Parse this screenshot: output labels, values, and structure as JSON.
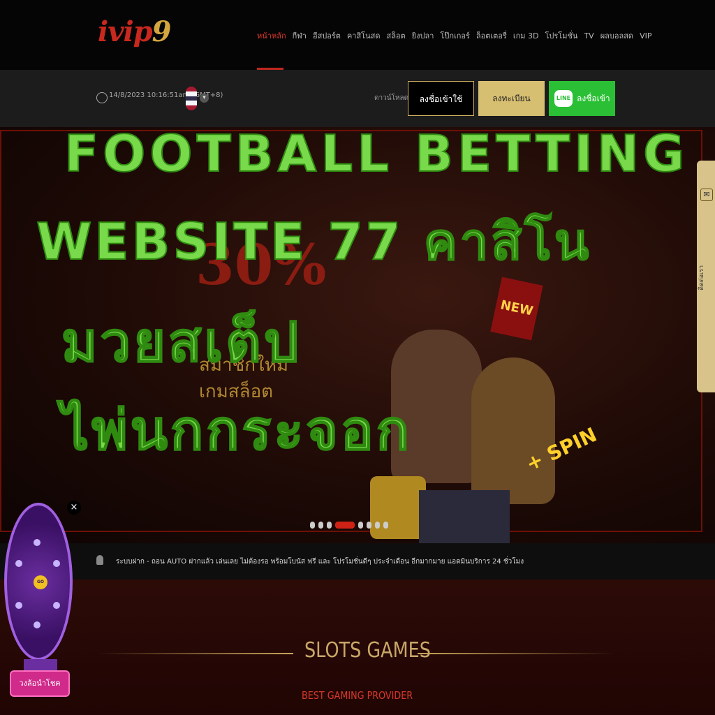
{
  "brand": {
    "logo_text": "ivip",
    "logo_suffix": "9"
  },
  "nav": {
    "items": [
      "หน้าหลัก",
      "กีฬา",
      "อีสปอร์ต",
      "คาสิโนสด",
      "สล็อต",
      "ยิงปลา",
      "โป๊กเกอร์",
      "ล็อตเตอรี่",
      "เกม 3D",
      "โปรโมชั่น",
      "TV",
      "ผลบอลสด",
      "VIP"
    ],
    "active_index": 0
  },
  "subbar": {
    "datetime": "14/8/2023 10:16:51am (GMT+8)",
    "download_label": "ดาวน์โหลด",
    "login_label": "ลงชื่อเข้าใช้",
    "register_label": "ลงทะเบียน",
    "line_login_label": "ลงชื่อเข้าใช้",
    "line_badge": "LINE"
  },
  "banner": {
    "new_badge": "NEW",
    "spin_text": "+ SPIN",
    "carousel_count": 8,
    "carousel_active": 3
  },
  "overlay": {
    "line1": "FOOTBALL BETTING",
    "line2": "WEBSITE 77 คาสิโน",
    "line3": "มวยสเต็ป",
    "line4": "ไพ่นกกระจอก"
  },
  "sidetab": {
    "label": "ติดต่อเรา"
  },
  "news": {
    "text": "ระบบฝาก - ถอน AUTO ฝากแล้ว เล่นเลย ไม่ต้องรอ พร้อมโบนัส ฟรี และ โปรโมชั่นดีๆ ประจำเดือน อีกมากมาย แอดมินบริการ 24 ชั่วโมง"
  },
  "section": {
    "title": "SLOTS GAMES",
    "subtitle": "BEST GAMING PROVIDER"
  },
  "wheel": {
    "label": "วงล้อนำโชค",
    "close": "×"
  },
  "colors": {
    "accent_red": "#c0281e",
    "gold": "#d7bf72",
    "line_green": "#2bbf35",
    "overlay_green": "#78d94a"
  }
}
